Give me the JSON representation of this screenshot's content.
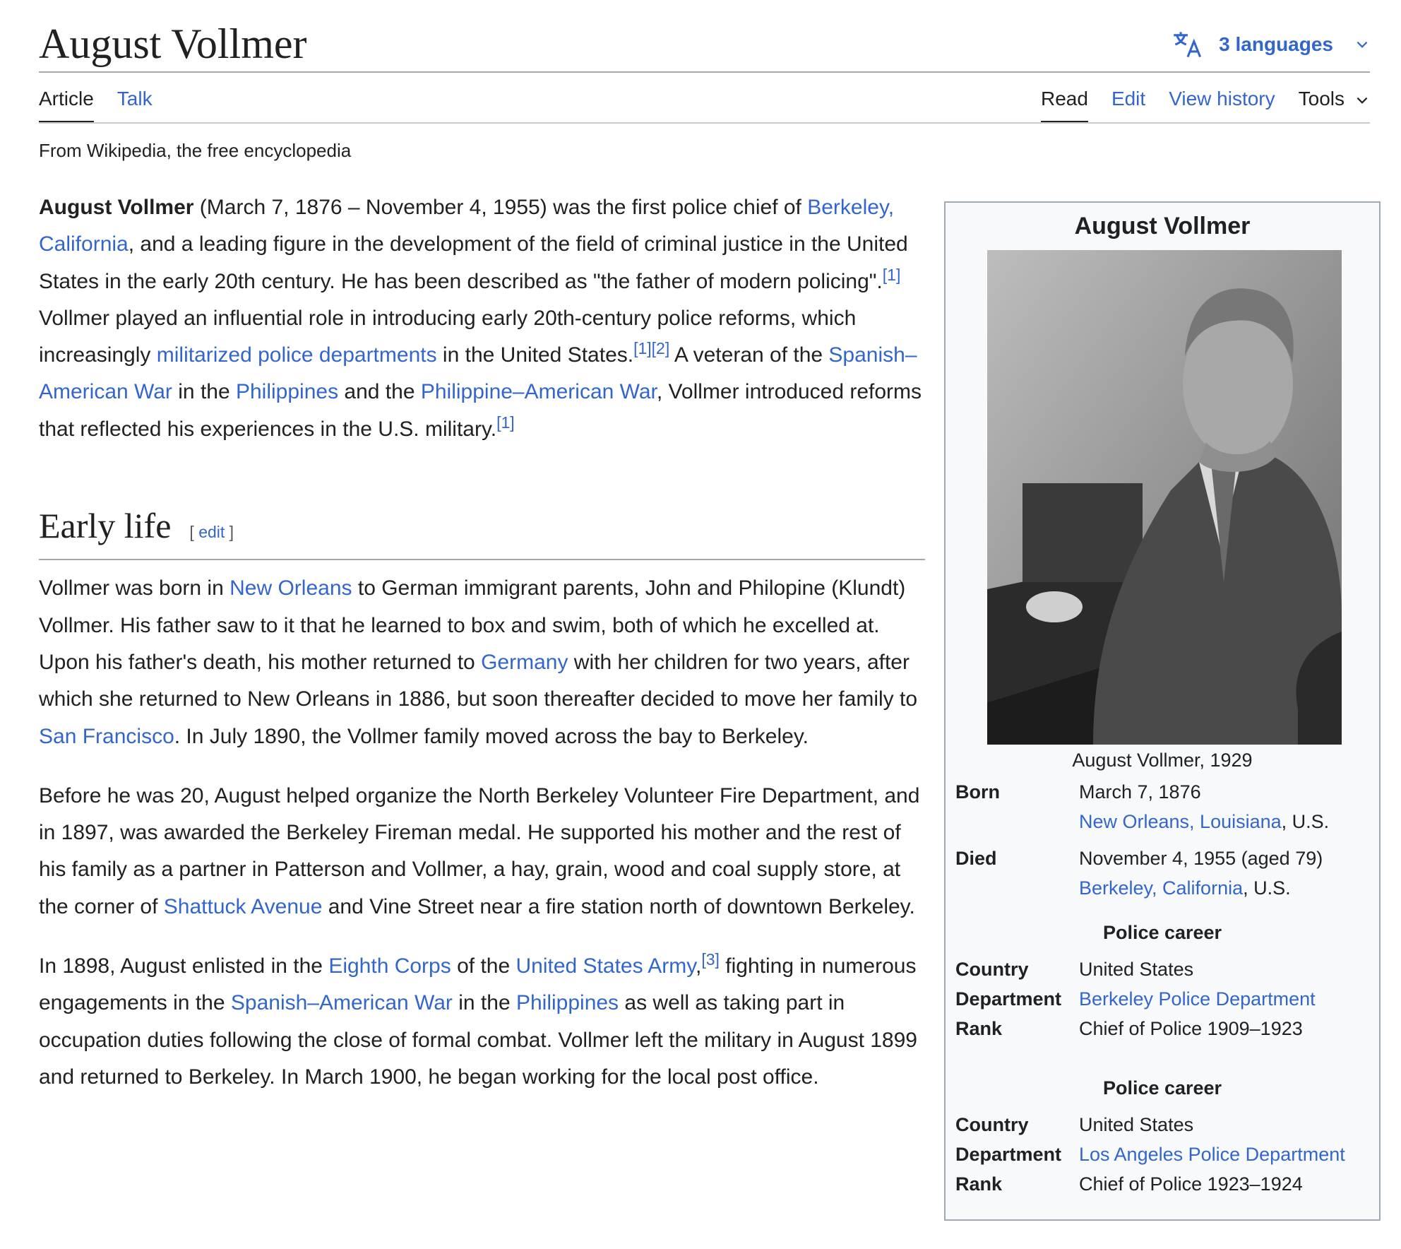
{
  "page": {
    "title": "August Vollmer",
    "languages_label": "3 languages",
    "tabs_left": [
      "Article",
      "Talk"
    ],
    "tabs_right": [
      "Read",
      "Edit",
      "View history"
    ],
    "tools_label": "Tools",
    "tagline": "From Wikipedia, the free encyclopedia"
  },
  "lead": {
    "bold_name": "August Vollmer",
    "t1": " (March 7, 1876 – November 4, 1955) was the first police chief of ",
    "l_berkeley": "Berkeley, California",
    "t2": ", and a leading figure in the development of the field of criminal justice in the United States in the early 20th century. He has been described as \"the father of modern policing\".",
    "ref1": "[1]",
    "t3": " Vollmer played an influential role in introducing early 20th-century police reforms, which increasingly ",
    "l_militarized": "militarized police departments",
    "t4": " in the United States.",
    "ref1b": "[1]",
    "ref2": "[2]",
    "t5": " A veteran of the ",
    "l_saw": "Spanish–American War",
    "t6": " in the ",
    "l_philippines": "Philippines",
    "t7": " and the ",
    "l_paw": "Philippine–American War",
    "t8": ", Vollmer introduced reforms that reflected his experiences in the U.S. military.",
    "ref1c": "[1]"
  },
  "early_life": {
    "heading": "Early life",
    "edit_bracket_open": "[ ",
    "edit_label": "edit",
    "edit_bracket_close": " ]",
    "p1": {
      "t1": "Vollmer was born in ",
      "l_no": "New Orleans",
      "t2": " to German immigrant parents, John and Philopine (Klundt) Vollmer. His father saw to it that he learned to box and swim, both of which he excelled at. Upon his father's death, his mother returned to ",
      "l_germany": "Germany",
      "t3": " with her children for two years, after which she returned to New Orleans in 1886, but soon thereafter decided to move her family to ",
      "l_sf": "San Francisco",
      "t4": ". In July 1890, the Vollmer family moved across the bay to Berkeley."
    },
    "p2": {
      "t1": "Before he was 20, August helped organize the North Berkeley Volunteer Fire Department, and in 1897, was awarded the Berkeley Fireman medal. He supported his mother and the rest of his family as a partner in Patterson and Vollmer, a hay, grain, wood and coal supply store, at the corner of ",
      "l_shattuck": "Shattuck Avenue",
      "t2": " and Vine Street near a fire station north of downtown Berkeley."
    },
    "p3": {
      "t1": "In 1898, August enlisted in the ",
      "l_eighth": "Eighth Corps",
      "t2": " of the ",
      "l_army": "United States Army",
      "t3": ",",
      "ref3": "[3]",
      "t4": " fighting in numerous engagements in the ",
      "l_saw": "Spanish–American War",
      "t5": " in the ",
      "l_philippines": "Philippines",
      "t6": " as well as taking part in occupation duties following the close of formal combat. Vollmer left the military in August 1899 and returned to Berkeley. In March 1900, he began working for the local post office."
    }
  },
  "infobox": {
    "title": "August Vollmer",
    "caption": "August Vollmer, 1929",
    "born_label": "Born",
    "born_date": "March 7, 1876",
    "born_place_link": "New Orleans, Louisiana",
    "born_place_suffix": ", U.S.",
    "died_label": "Died",
    "died_date": "November 4, 1955 (aged 79)",
    "died_place_link": "Berkeley, California",
    "died_place_suffix": ", U.S.",
    "careers": [
      {
        "heading": "Police career",
        "country_label": "Country",
        "country": "United States",
        "department_label": "Department",
        "department": "Berkeley Police Department",
        "rank_label": "Rank",
        "rank": "Chief of Police 1909–1923"
      },
      {
        "heading": "Police career",
        "country_label": "Country",
        "country": "United States",
        "department_label": "Department",
        "department": "Los Angeles Police Department",
        "rank_label": "Rank",
        "rank": "Chief of Police 1923–1924"
      }
    ]
  },
  "icons": {
    "translate": "translate-icon",
    "chevron": "chevron-down-icon"
  }
}
